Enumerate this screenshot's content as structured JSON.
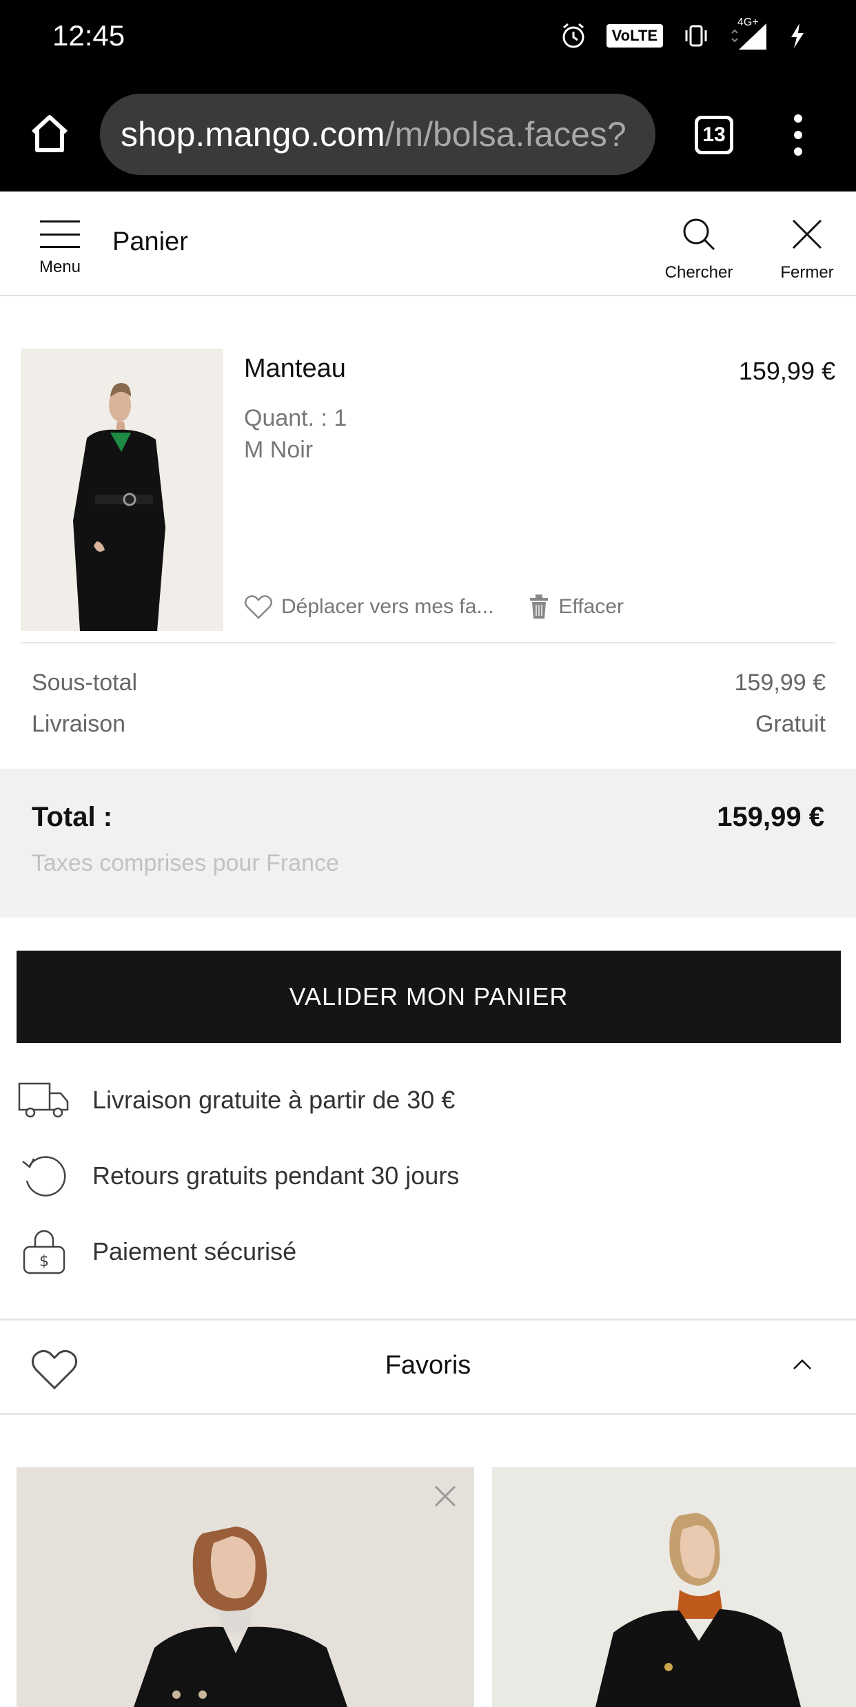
{
  "status_bar": {
    "time": "12:45",
    "volte": "VoLTE",
    "network": "4G+"
  },
  "browser": {
    "url_host": "shop.mango.com",
    "url_path": "/m/bolsa.faces?",
    "tab_count": "13"
  },
  "header": {
    "menu_label": "Menu",
    "title": "Panier",
    "search_label": "Chercher",
    "close_label": "Fermer"
  },
  "cart_item": {
    "name": "Manteau",
    "price": "159,99 €",
    "quantity": "Quant. : 1",
    "variant": "M  Noir",
    "move_to_favorites": "Déplacer vers mes fa...",
    "delete": "Effacer"
  },
  "summary": {
    "subtotal_label": "Sous-total",
    "subtotal_value": "159,99 €",
    "shipping_label": "Livraison",
    "shipping_value": "Gratuit",
    "total_label": "Total :",
    "total_value": "159,99 €",
    "tax_note": "Taxes comprises pour France"
  },
  "checkout_button": "VALIDER MON PANIER",
  "perks": [
    {
      "icon": "truck-icon",
      "text": "Livraison gratuite à partir de 30 €"
    },
    {
      "icon": "return-icon",
      "text": "Retours gratuits pendant 30 jours"
    },
    {
      "icon": "secure-lock-icon",
      "text": "Paiement sécurisé"
    }
  ],
  "favorites": {
    "title": "Favoris"
  }
}
